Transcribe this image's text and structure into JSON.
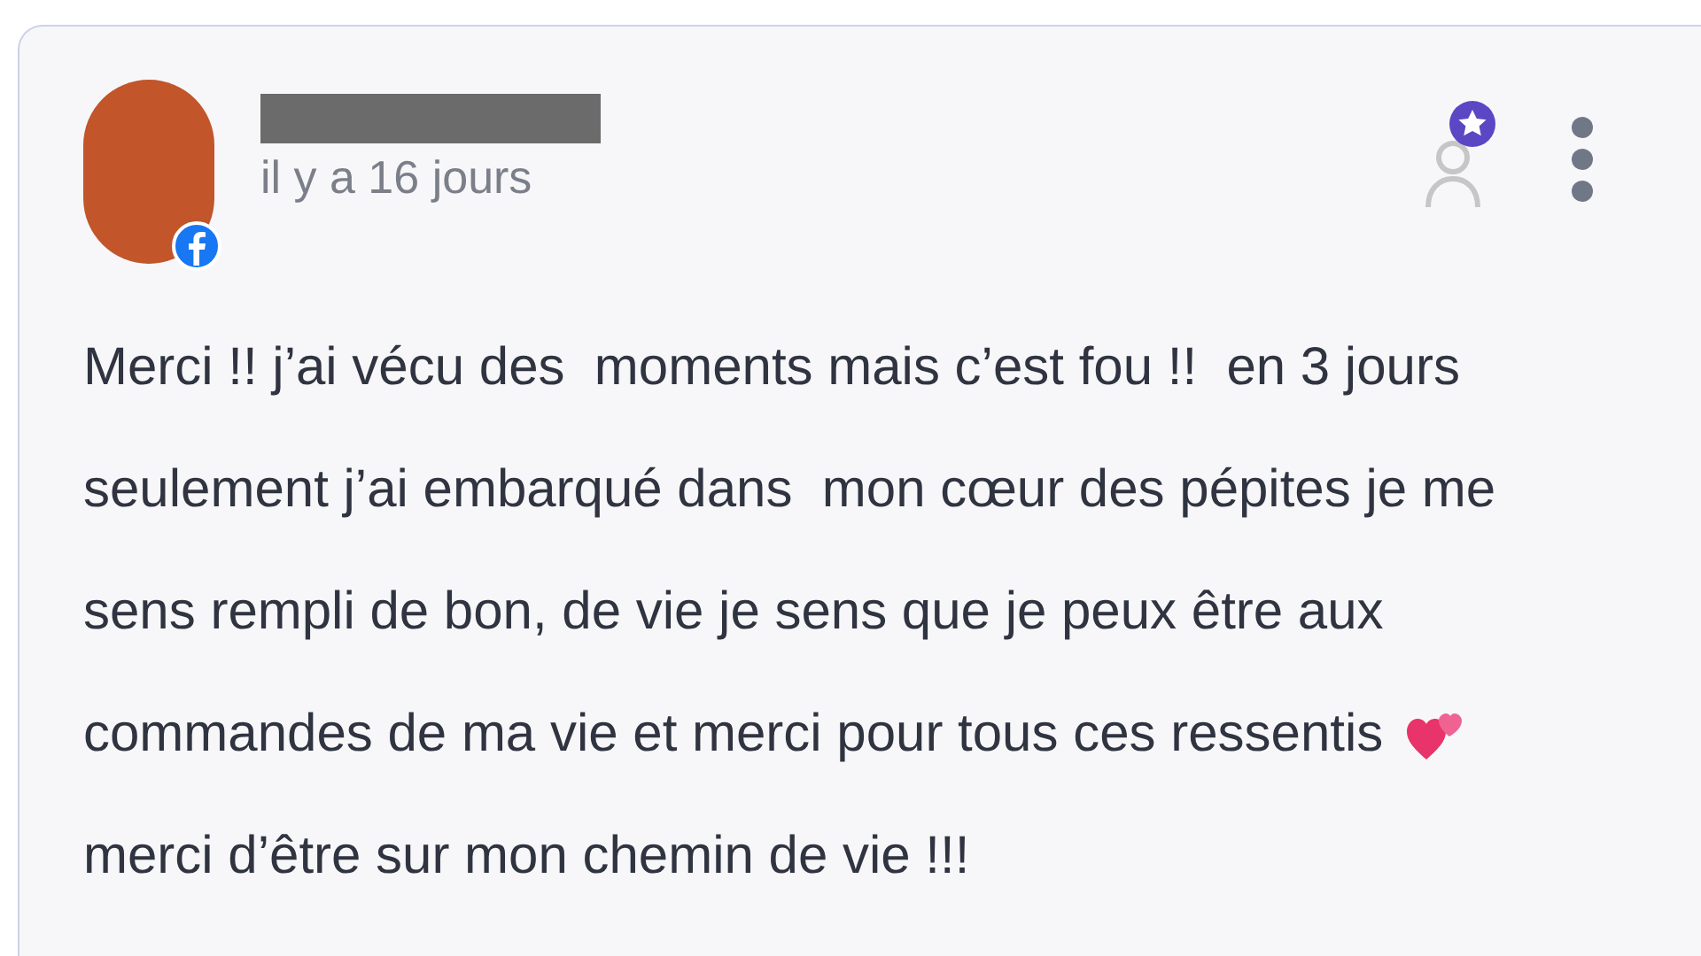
{
  "review": {
    "time": "il y a 16 jours",
    "lines": [
      "Merci !! j’ai vécu des  moments mais c’est fou !!  en 3 jours",
      "seulement j’ai embarqué dans  mon cœur des pépites je me",
      "sens rempli de bon, de vie je sens que je peux être aux",
      "commandes de ma vie et merci pour tous ces ressentis",
      "merci d’être sur mon chemin de vie !!!"
    ]
  }
}
